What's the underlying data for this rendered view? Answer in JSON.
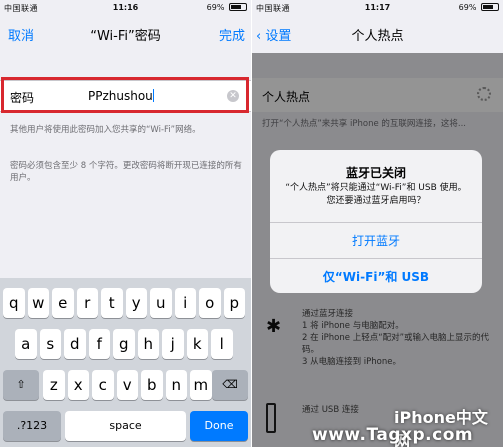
{
  "left": {
    "status": {
      "carrier": "中国联通",
      "time": "11:16",
      "battery": "69%"
    },
    "nav": {
      "cancel": "取消",
      "title": "“Wi-Fi”密码",
      "done": "完成"
    },
    "field": {
      "label": "密码",
      "value": "PPzhushou"
    },
    "notes": [
      "其他用户将使用此密码加入您共享的“Wi-Fi”网络。",
      "密码必须包含至少 8 个字符。更改密码将断开现已连接的所有用户。"
    ],
    "keyboard": {
      "row1": [
        "q",
        "w",
        "e",
        "r",
        "t",
        "y",
        "u",
        "i",
        "o",
        "p"
      ],
      "row2": [
        "a",
        "s",
        "d",
        "f",
        "g",
        "h",
        "j",
        "k",
        "l"
      ],
      "row3": [
        "z",
        "x",
        "c",
        "v",
        "b",
        "n",
        "m"
      ],
      "mode": ".?123",
      "space": "space",
      "done": "Done"
    }
  },
  "right": {
    "status": {
      "carrier": "中国联通",
      "time": "11:17",
      "battery": "69%"
    },
    "nav": {
      "back": "设置",
      "title": "个人热点"
    },
    "hotspot_row": "个人热点",
    "bg_text_1": "打开“个人热点”来共享 iPhone 的互联网连接，这将...",
    "bg_text_2": "通过蓝牙连接",
    "bg_steps": [
      "1 将 iPhone 与电脑配对。",
      "2 在 iPhone 上轻点“配对”或输入电脑上显示的代码。",
      "3 从电脑连接到 iPhone。"
    ],
    "bg_text_3": "通过 USB 连接",
    "alert": {
      "title": "蓝牙已关闭",
      "message": "“个人热点”将只能通过“Wi-Fi”和 USB 使用。您还要通过蓝牙启用吗？",
      "btn1": "打开蓝牙",
      "btn2": "仅“Wi-Fi”和 USB"
    }
  },
  "watermark": {
    "brand": "iPhone中文网",
    "url": "www.Tagxp.com"
  },
  "colors": {
    "accent": "#007aff",
    "highlight": "#d8282f",
    "keyboard_bg": "#d1d5db"
  }
}
